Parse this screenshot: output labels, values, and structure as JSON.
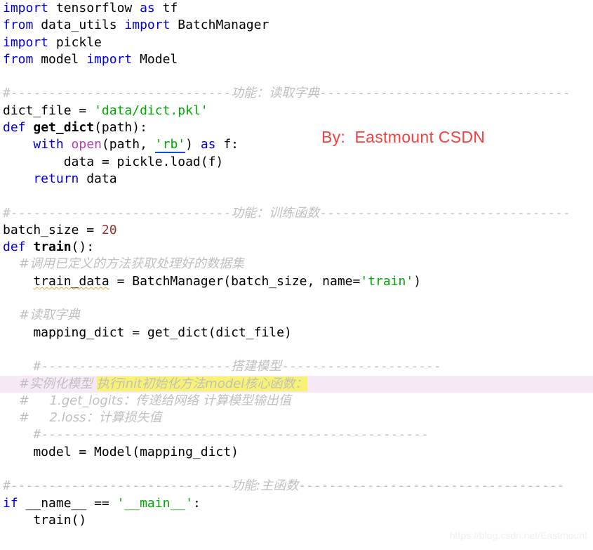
{
  "editor": {
    "background": "#ffffff",
    "language": "python",
    "font_size_px": 18
  },
  "colors": {
    "keyword": "#0000e0",
    "identifier": "#000000",
    "function_name": "#000000",
    "builtin": "#b33fb3",
    "string": "#00aa00",
    "number": "#993333",
    "comment": "#c0c0c0",
    "row_highlight_pink": "#f6e8f6",
    "text_highlight_yellow": "#f7f274",
    "author_stamp_red": "#f5403c",
    "watermark_gray": "#f0f0f0",
    "spellcheck_squiggle": "#d8a93a"
  },
  "overlays": {
    "author_stamp": "By:  Eastmount CSDN",
    "watermark": "https://blog.csdn.net/Eastmount"
  },
  "code": {
    "l01_import": "import",
    "l01_mod": " tensorflow ",
    "l01_as": "as",
    "l01_alias": " tf",
    "l02_from": "from",
    "l02_mod": " data_utils ",
    "l02_import": "import",
    "l02_name": " BatchManager",
    "l03_import": "import",
    "l03_mod": " pickle",
    "l04_from": "from",
    "l04_mod": " model ",
    "l04_import": "import",
    "l04_name": " Model",
    "l06_hash": "#",
    "l06_dash_left": "-----------------------------",
    "l06_label": "功能：读取字典",
    "l06_dash_right": "---------------------------------",
    "l07_var": "dict_file ",
    "l07_eq": "= ",
    "l07_str": "'data/dict.pkl'",
    "l08_def": "def",
    "l08_fn": " get_dict",
    "l08_args": "(path):",
    "l09_with": "with",
    "l09_open": " open",
    "l09_a": "(path, ",
    "l09_str": "'rb'",
    "l09_b": ") ",
    "l09_as": "as",
    "l09_f": " f:",
    "l10_body": "        data = pickle.load(f)",
    "l11_return": "    return",
    "l11_val": " data",
    "l13_hash": "#",
    "l13_dash_left": "-----------------------------",
    "l13_label": "功能：训练函数",
    "l13_dash_right": "---------------------------------",
    "l14_var": "batch_size ",
    "l14_eq": "= ",
    "l14_num": "20",
    "l15_def": "def",
    "l15_fn": " train",
    "l15_args": "():",
    "l16_comment": "    #调用已定义的方法获取处理好的数据集",
    "l17_indent": "    ",
    "l17_var": "train_data",
    "l17_mid": " = BatchManager(batch_size, name=",
    "l17_str": "'train'",
    "l17_end": ")",
    "l19_comment": "    #读取字典",
    "l20_code": "    mapping_dict = get_dict(dict_file)",
    "l22_hash": "    #",
    "l22_dash_left": "-------------------------",
    "l22_label": "搭建模型",
    "l22_dash_right": "---------------------",
    "l23_pre": "    #实例化模型 ",
    "l23_hl": "执行init初始化方法model核心函数：",
    "l24_comment": "    #     1.get_logits：传递给网络 计算模型输出值",
    "l25_comment": "    #     2.loss：计算损失值",
    "l26_hash": "    #",
    "l26_dash": "---------------------------------------------------",
    "l27_code": "    model = Model(mapping_dict)",
    "l29_hash": "#",
    "l29_dash_left": "-----------------------------",
    "l29_label": "功能:主函数",
    "l29_dash_right": "-----------------------------------",
    "l30_if": "if",
    "l30_name": " __name__ ",
    "l30_eq": "== ",
    "l30_str": "'__main__'",
    "l30_colon": ":",
    "l31_call": "    train()"
  }
}
